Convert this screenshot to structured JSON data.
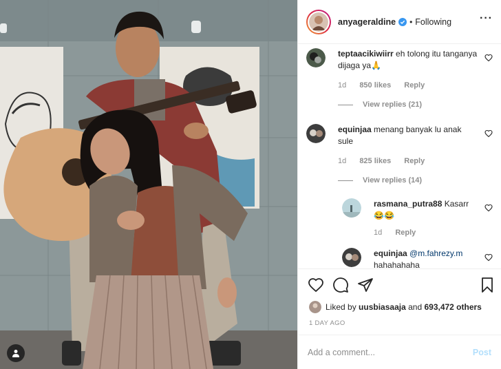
{
  "post": {
    "username": "anyageraldine",
    "follow_status": "Following",
    "dot": "•"
  },
  "comments": [
    {
      "username": "teptaacikiwiirr",
      "text": "eh tolong itu tanganya dijaga ya🙏",
      "age": "1d",
      "likes": "850 likes",
      "reply_label": "Reply",
      "view_replies": "View replies (21)"
    },
    {
      "username": "equinjaa",
      "text": "menang banyak lu anak sule",
      "age": "1d",
      "likes": "825 likes",
      "reply_label": "Reply",
      "view_replies": "View replies (14)"
    }
  ],
  "replies": [
    {
      "username": "rasmana_putra88",
      "text": "Kasarr 😂😂",
      "age": "1d",
      "reply_label": "Reply"
    },
    {
      "username": "equinjaa",
      "mention": "@m.fahrezy.m",
      "text": "hahahahaha"
    }
  ],
  "likes": {
    "prefix": "Liked by",
    "user": "uusbiasaaja",
    "middle": "and",
    "count": "693,472 others"
  },
  "timestamp": "1 DAY AGO",
  "composer": {
    "placeholder": "Add a comment...",
    "post_label": "Post"
  },
  "colors": {
    "accent_link": "#00376b",
    "muted": "#8e8e8e",
    "post_disabled": "#b2dffc",
    "verified": "#3897f0"
  }
}
